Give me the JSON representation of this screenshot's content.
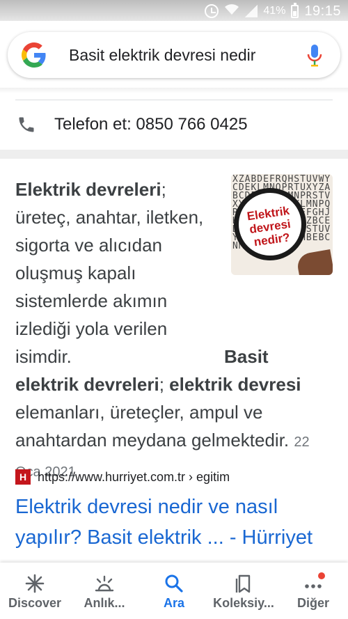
{
  "status_bar": {
    "battery_percent": "41%",
    "time": "19:15",
    "icons": [
      "alarm-icon",
      "wifi-icon",
      "signal-icon",
      "battery-icon"
    ]
  },
  "search": {
    "query": "Basit elektrik devresi nedir",
    "icons": [
      "google-logo",
      "mic-icon"
    ]
  },
  "call_row": {
    "icon": "phone-icon",
    "label": "Telefon et: 0850 766 0425"
  },
  "snippet": {
    "image_lines": [
      "Elektrik",
      "devresi",
      "nedir?"
    ],
    "text_parts": {
      "b1": "Elektrik devreleri",
      "t1": "; üreteç, anahtar, iletken, sigorta ve alıcıdan oluşmuş kapalı sistemlerde akımın izlediği yola verilen isimdir. ",
      "b2": "Basit elektrik devreleri",
      "t2": "; ",
      "b3": "elektrik devresi",
      "t3": " elemanları, üreteçler, ampul ve anahtardan meydana gelmektedir."
    },
    "date": "22 Oca 2021",
    "source_url": "https://www.hurriyet.com.tr › egitim",
    "result_title": "Elektrik devresi nedir ve nasıl yapılır? Basit elektrik ... - Hürriyet"
  },
  "bottom_nav": {
    "items": [
      {
        "label": "Discover",
        "icon": "asterisk-icon",
        "active": false
      },
      {
        "label": "Anlık...",
        "icon": "updates-icon",
        "active": false
      },
      {
        "label": "Ara",
        "icon": "search-icon",
        "active": true
      },
      {
        "label": "Koleksiy...",
        "icon": "collections-icon",
        "active": false
      },
      {
        "label": "Diğer",
        "icon": "more-icon",
        "active": false
      }
    ]
  },
  "colors": {
    "link": "#1967d2",
    "active_nav": "#1a73e8",
    "brand_red": "#c4161c",
    "notification_dot": "#ea4335"
  }
}
